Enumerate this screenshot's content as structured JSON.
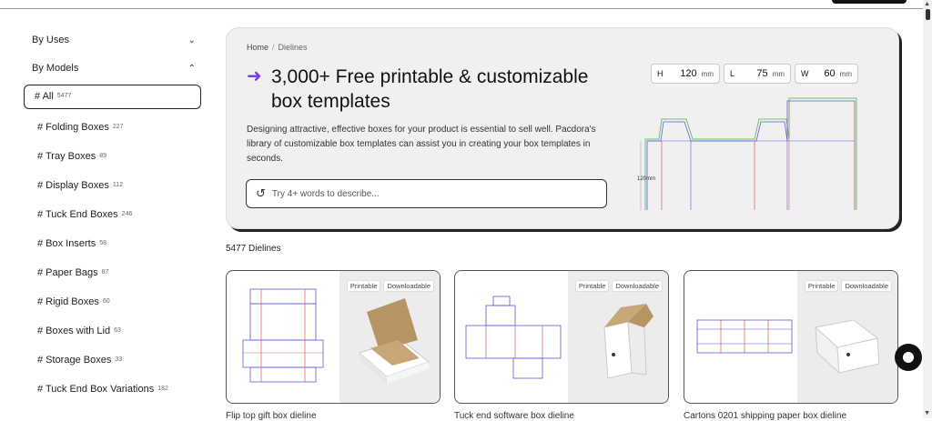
{
  "sidebar": {
    "groups": [
      {
        "label": "By Uses",
        "chevron": "chevron-down-icon"
      },
      {
        "label": "By Models",
        "chevron": "chevron-up-icon"
      }
    ],
    "items": [
      {
        "label": "# All",
        "count": "5477"
      },
      {
        "label": "# Folding Boxes",
        "count": "227"
      },
      {
        "label": "# Tray Boxes",
        "count": "89"
      },
      {
        "label": "# Display Boxes",
        "count": "112"
      },
      {
        "label": "# Tuck End Boxes",
        "count": "246"
      },
      {
        "label": "# Box Inserts",
        "count": "58"
      },
      {
        "label": "# Paper Bags",
        "count": "87"
      },
      {
        "label": "# Rigid Boxes",
        "count": "60"
      },
      {
        "label": "# Boxes with Lid",
        "count": "63"
      },
      {
        "label": "# Storage Boxes",
        "count": "33"
      },
      {
        "label": "# Tuck End Box Variations",
        "count": "182"
      }
    ]
  },
  "hero": {
    "breadcrumb": {
      "home": "Home",
      "separator": "/",
      "current": "Dielines"
    },
    "title_line1": "3,000+ Free printable & customizable",
    "title_line2": "box templates",
    "description": "Designing attractive, effective boxes for your product is essential to sell well. Pacdora's library of customizable box templates can assist you in creating your box templates in seconds.",
    "search_placeholder": "Try 4+ words to describe...",
    "dimensions": [
      {
        "label": "H",
        "value": "120",
        "unit": "mm"
      },
      {
        "label": "L",
        "value": "75",
        "unit": "mm"
      },
      {
        "label": "W",
        "value": "60",
        "unit": "mm"
      }
    ],
    "height_label": "120mm"
  },
  "results_count": "5477 Dielines",
  "cards": [
    {
      "tags": [
        "Printable",
        "Downloadable"
      ],
      "title": "Flip top gift box dieline"
    },
    {
      "tags": [
        "Printable",
        "Downloadable"
      ],
      "title": "Tuck end software box dieline"
    },
    {
      "tags": [
        "Printable",
        "Downloadable"
      ],
      "title": "Cartons 0201 shipping paper box dieline"
    }
  ],
  "colors": {
    "accent": "#7b3cf0",
    "hero_bg": "#f0f0f0",
    "dieline_blue": "#5b5bd6",
    "dieline_red": "#e06a6a",
    "dieline_green": "#6dbf6d"
  }
}
